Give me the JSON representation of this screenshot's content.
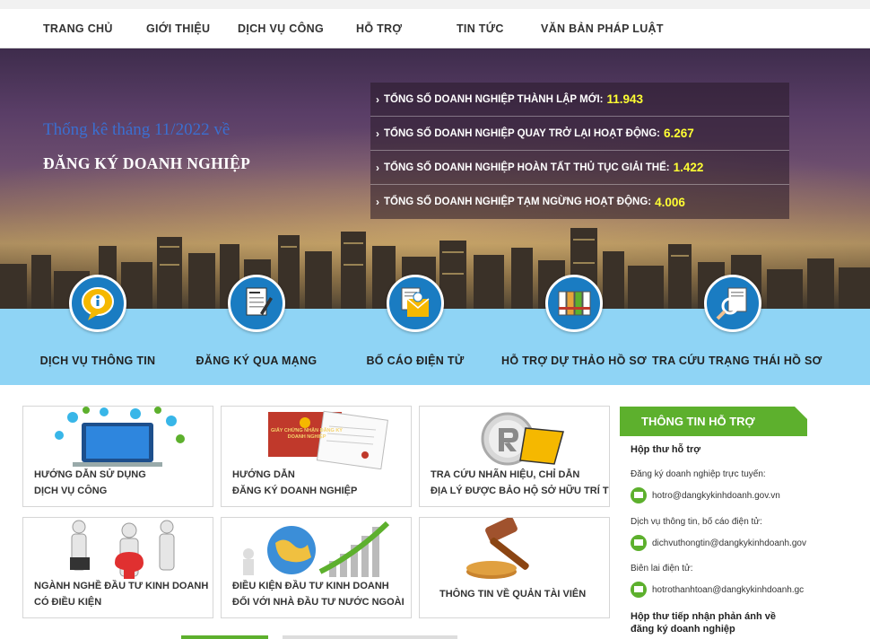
{
  "nav": {
    "items": [
      "TRANG CHỦ",
      "GIỚI THIỆU",
      "DỊCH VỤ CÔNG",
      "HỖ TRỢ",
      "TIN TỨC",
      "VĂN BẢN PHÁP LUẬT"
    ]
  },
  "hero": {
    "subtitle": "Thống kê tháng 11/2022 về",
    "title": "ĐĂNG KÝ DOANH NGHIỆP",
    "stats": [
      {
        "label": "TỔNG SỐ DOANH NGHIỆP THÀNH LẬP MỚI:",
        "value": "11.943"
      },
      {
        "label": "TỔNG SỐ DOANH NGHIỆP QUAY TRỞ LẠI HOẠT ĐỘNG:",
        "value": "6.267"
      },
      {
        "label": "TỔNG SỐ DOANH NGHIỆP HOÀN TẤT THỦ TỤC GIẢI THỂ:",
        "value": "1.422"
      },
      {
        "label": "TỔNG SỐ DOANH NGHIỆP TẠM NGỪNG HOẠT ĐỘNG:",
        "value": "4.006"
      }
    ]
  },
  "services": [
    {
      "label": "DỊCH VỤ THÔNG TIN",
      "icon": "info-bubble-icon"
    },
    {
      "label": "ĐĂNG KÝ QUA MẠNG",
      "icon": "registration-form-icon"
    },
    {
      "label": "BỐ CÁO ĐIỆN TỬ",
      "icon": "email-document-icon"
    },
    {
      "label": "HỖ TRỢ DỰ THẢO HỒ SƠ",
      "icon": "binders-icon"
    },
    {
      "label": "TRA CỨU TRẠNG THÁI HỒ SƠ",
      "icon": "magnifier-document-icon"
    }
  ],
  "cards": [
    {
      "line1": "HƯỚNG DẪN SỬ DỤNG",
      "line2": "DỊCH VỤ CÔNG"
    },
    {
      "line1": "HƯỚNG DẪN",
      "line2": "ĐĂNG KÝ DOANH NGHIỆP",
      "art_text": "GIẤY CHỨNG NHẬN ĐĂNG KÝ DOANH NGHIỆP"
    },
    {
      "line1": "TRA CỨU NHÃN HIỆU, CHỈ DẪN",
      "line2": "ĐỊA LÝ ĐƯỢC BẢO HỘ SỞ HỮU TRÍ TUỆ"
    },
    {
      "line1": "NGÀNH NGHỀ ĐẦU TƯ KINH DOANH",
      "line2": "CÓ ĐIỀU KIỆN"
    },
    {
      "line1": "ĐIỀU KIỆN ĐẦU TƯ KINH DOANH",
      "line2": "ĐỐI VỚI NHÀ ĐẦU TƯ NƯỚC NGOÀI"
    },
    {
      "line1": "THÔNG TIN VỀ QUẢN TÀI VIÊN",
      "line2": ""
    }
  ],
  "sidebar": {
    "heading": "THÔNG TIN HỖ TRỢ",
    "mailbox_title": "Hộp thư hỗ trợ",
    "online_label": "Đăng ký doanh nghiệp trực tuyến:",
    "online_email": "hotro@dangkykinhdoanh.gov.vn",
    "info_label": "Dịch vụ thông tin, bố cáo điện tử:",
    "info_email": "dichvuthongtin@dangkykinhdoanh.gov",
    "receipt_label": "Biên lai điện tử:",
    "receipt_email": "hotrothanhtoan@dangkykinhdoanh.gc",
    "feedback_title_1": "Hộp thư tiếp nhận phản ánh về",
    "feedback_title_2": "đăng ký doanh nghiệp"
  },
  "colors": {
    "accent_green": "#5db02d",
    "service_band": "#8fd4f5",
    "icon_blue": "#1a7cc2",
    "stat_value": "#ffff33"
  }
}
